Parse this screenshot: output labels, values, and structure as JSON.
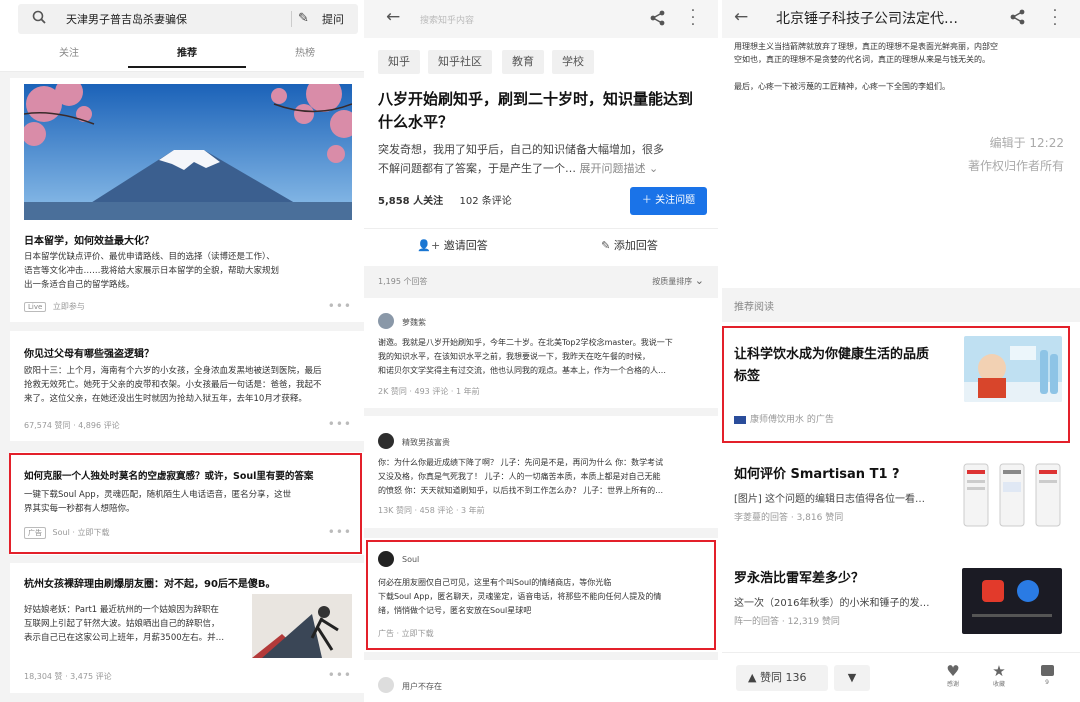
{
  "panel1": {
    "search": {
      "query": "天津男子普吉岛杀妻骗保",
      "ask_label": "提问"
    },
    "tabs": [
      {
        "label": "关注"
      },
      {
        "label": "推荐"
      },
      {
        "label": "热榜"
      }
    ],
    "cards": [
      {
        "title": "日本留学，如何效益最大化？",
        "body": [
          "日本留学优缺点评价、最优申请路线、目的选择（读博还是工作）、",
          "语言等文化冲击……我将给大家展示日本留学的全貌，帮助大家规划",
          "出一条适合自己的留学路线。"
        ],
        "tag": "Live",
        "meta": "立即参与"
      },
      {
        "title": "你见过父母有哪些强盗逻辑？",
        "body": [
          "欧阳十三：上个月，海南有个六岁的小女孩，全身浓血发黑地被送到医院，最后",
          "抢救无效死亡。她死于父亲的皮带和衣架。小女孩最后一句话是：爸爸，我起不",
          "来了。这位父亲，在她还没出生时就因为抢劫入狱五年，去年10月才获释。"
        ],
        "meta": "67,574 赞同 · 4,896 评论"
      },
      {
        "title": "如何克服一个人独处时莫名的空虚寂寞感？或许，Soul里有要的答案",
        "body": [
          "一键下载Soul App，灵魂匹配，随机陌生人电话语音，匿名分享，这世",
          "界其实每一秒都有人想陪你。"
        ],
        "tag": "广告",
        "meta": "Soul · 立即下载"
      },
      {
        "title": "杭州女孩裸辞理由刷爆朋友圈：对不起，90后不是傻B。",
        "body": [
          "好姑娘老妖：Part1 最近杭州的一个姑娘因为辞职在",
          "互联网上引起了轩然大波。姑娘晒出自己的辞职信，",
          "表示自己已在这家公司上班年，月薪3500左右。并…"
        ],
        "meta": "18,304 赞 · 3,475 评论"
      }
    ]
  },
  "panel2": {
    "search_placeholder": "搜索知乎内容",
    "chips": [
      "知乎",
      "知乎社区",
      "教育",
      "学校"
    ],
    "title": [
      "八岁开始刷知乎，刷到二十岁时，知识量能达到",
      "什么水平？"
    ],
    "desc": [
      "突发奇想，我用了知乎后，自己的知识储备大幅增加，很多",
      "不解问题都有了答案，于是产生了一个…"
    ],
    "expand": "展开问题描述",
    "followers": "5,858 人关注",
    "comments": "102 条评论",
    "follow_label": "关注问题",
    "invite_label": "邀请回答",
    "add_label": "添加回答",
    "answer_count": "1,195 个回答",
    "sort_label": "按质量排序",
    "answers": [
      {
        "name": "萝魏紫",
        "body": [
          "谢邀。我就是八岁开始刷知乎，今年二十岁。在北美Top2学校念master。我说一下",
          "我的知识水平，在该知识水平之前，我想要说一下，我昨天在吃午餐的时候，",
          "和诺贝尔文学奖得主有过交流，他也认同我的观点。基本上，作为一个合格的人…"
        ],
        "meta": "2K 赞同 · 493 评论 · 1 年前"
      },
      {
        "name": "精致男孩富贵",
        "body": [
          "你：为什么你最近成绩下降了啊？ 儿子：先问是不是，再问为什么 你：数学考试",
          "又没及格，你真是气死我了！ 儿子：人的一切痛苦本质，本质上都是对自己无能",
          "的愤怒 你：天天就知道刷知乎，以后找不到工作怎么办？ 儿子：世界上所有的…"
        ],
        "meta": "13K 赞同 · 458 评论 · 3 年前"
      },
      {
        "name": "Soul",
        "body": [
          "何必在朋友圈仅自己可见，这里有个叫Soul的情绪商店，等你光临",
          "下载Soul App，匿名聊天，灵魂鉴定，语音电话，将那些不能向任何人提及的情",
          "绪，悄悄做个记号，匿名安放在Soul星球吧"
        ],
        "meta": "广告 · 立即下载"
      },
      {
        "name": "用户不存在",
        "body": [],
        "meta": ""
      }
    ]
  },
  "panel3": {
    "title": "北京锤子科技子公司法定代…",
    "text_lines": [
      "用理想主义当挡箭牌就放弃了理想，真正的理想不是表面光鲜亮丽，内部空",
      "空如也，真正的理想不是贪婪的代名词，真正的理想从来是与钱无关的。"
    ],
    "closing": "最后，心疼一下被污蔑的工匠精神，心疼一下全国的李姐们。",
    "edited": "编辑于 12:22",
    "copyright": "著作权归作者所有",
    "rec_header": "推荐阅读",
    "recs": [
      {
        "title": [
          "让科学饮水成为你健康生活的品质",
          "标签"
        ],
        "meta": "康师傅饮用水 的广告"
      },
      {
        "title": [
          "如何评价 Smartisan T1 ?"
        ],
        "sub": "[图片] 这个问题的编辑日志值得各位一看…",
        "meta": "李菱蔓的回答 · 3,816 赞同"
      },
      {
        "title": [
          "罗永浩比雷军差多少？"
        ],
        "sub": "这一次（2016年秋季）的小米和锤子的发…",
        "meta": "阵一的回答 · 12,319 赞同"
      }
    ],
    "vote_label": "赞同 136",
    "actions": [
      {
        "label": "感谢"
      },
      {
        "label": "收藏"
      },
      {
        "label": "9"
      }
    ]
  }
}
